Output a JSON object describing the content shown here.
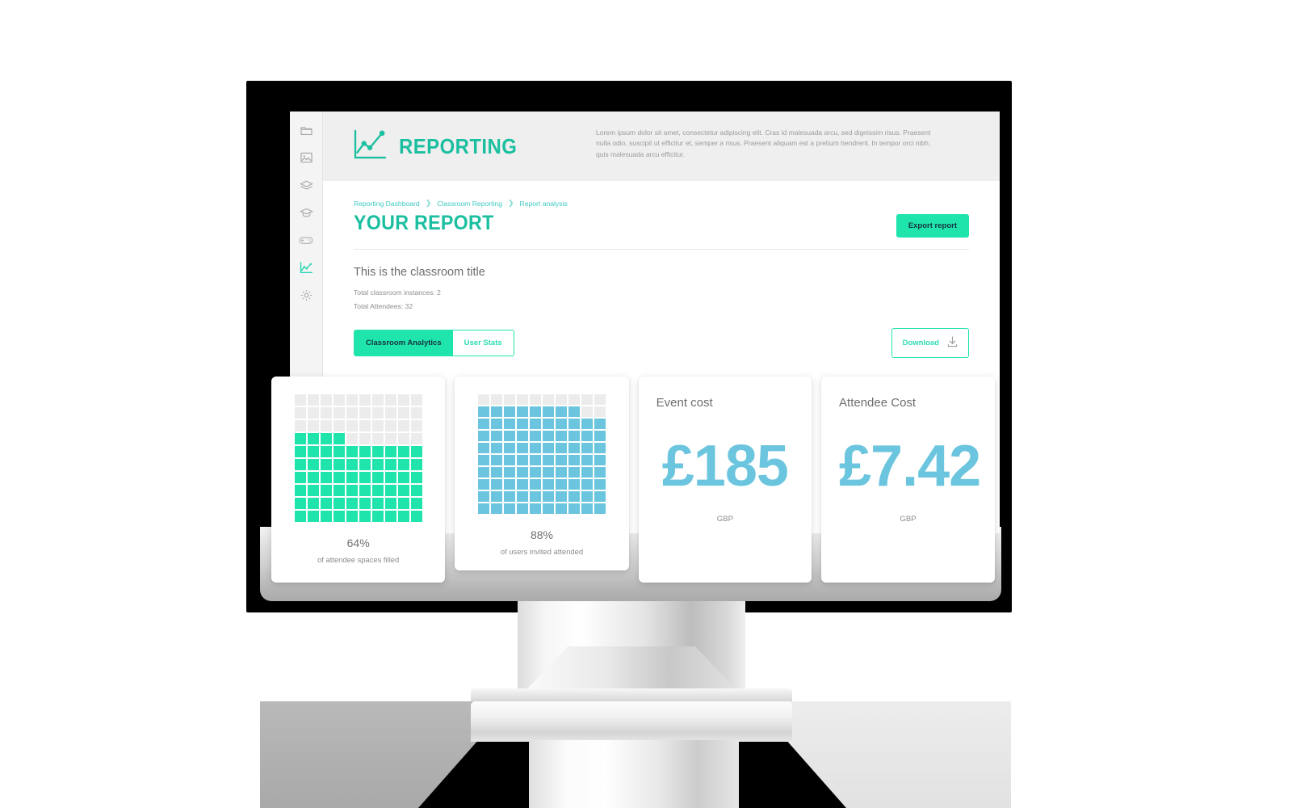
{
  "sidebar": {
    "items": [
      {
        "icon": "folder-icon",
        "active": false
      },
      {
        "icon": "image-icon",
        "active": false
      },
      {
        "icon": "book-icon",
        "active": false
      },
      {
        "icon": "graduation-cap-icon",
        "active": false
      },
      {
        "icon": "game-controller-icon",
        "active": false
      },
      {
        "icon": "line-chart-icon",
        "active": true
      },
      {
        "icon": "gear-icon",
        "active": false
      }
    ]
  },
  "hero": {
    "icon": "line-chart-icon",
    "title": "REPORTING",
    "description": "Lorem ipsum dolor sit amet, consectetur adipiscing elit. Cras id malesuada arcu, sed dignissim risus. Praesent nulla odio, suscipit ut efficitur et, semper a risus. Praesent aliquam est a pretium hendrerit. In tempor orci nibh, quis malesuada arcu efficitur."
  },
  "breadcrumb": {
    "items": [
      "Reporting Dashboard",
      "Classroom Reporting",
      "Report analysis"
    ],
    "separator": "❯"
  },
  "page": {
    "title": "YOUR REPORT",
    "export_label": "Export report",
    "classroom_title": "This is the classroom title",
    "meta": [
      "Total classroom instances: 2",
      "Total Attendees: 32"
    ]
  },
  "tabs": [
    {
      "label": "Classroom Analytics",
      "active": true
    },
    {
      "label": "User Stats",
      "active": false
    }
  ],
  "download": {
    "label": "Download",
    "icon": "download-icon"
  },
  "colors": {
    "mint": "#1fe5ad",
    "mint_dark": "#1bbfa0",
    "blue": "#6bc5de",
    "grid_empty": "#ececec",
    "text_dark": "#16323f"
  },
  "chart_data": [
    {
      "type": "waffle",
      "title": "64%",
      "label": "of attendee spaces filled",
      "value": 64,
      "total": 100,
      "rows": 10,
      "cols": 10,
      "fill_color": "#1fe5ad",
      "empty_color": "#ececec",
      "fill_order": "bottom-up-left-to-right"
    },
    {
      "type": "waffle",
      "title": "88%",
      "label": "of users invited attended",
      "value": 88,
      "total": 100,
      "rows": 10,
      "cols": 10,
      "fill_color": "#6bc5de",
      "empty_color": "#ececec",
      "fill_order": "bottom-up-left-to-right"
    },
    {
      "type": "value",
      "title": "Event cost",
      "value": "£185",
      "currency": "GBP",
      "color": "#6bc5de"
    },
    {
      "type": "value",
      "title": "Attendee Cost",
      "value": "£7.42",
      "currency": "GBP",
      "color": "#6bc5de"
    }
  ]
}
